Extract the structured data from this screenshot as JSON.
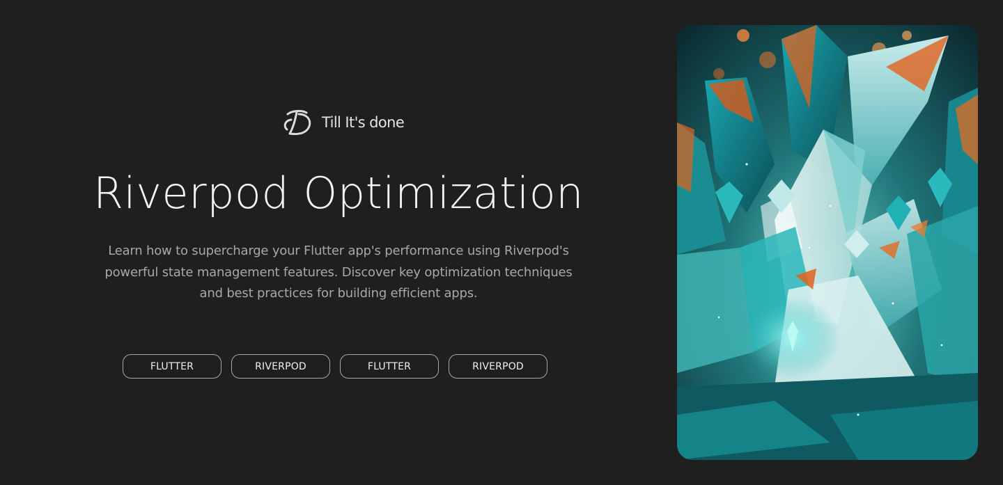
{
  "brand": {
    "name": "Till It's done",
    "logo_icon": "td-monogram-logo"
  },
  "hero": {
    "title": "Riverpod Optimization",
    "description": "Learn how to supercharge your Flutter app's performance using Riverpod's powerful state management features. Discover key optimization techniques and best practices for building efficient apps."
  },
  "tags": [
    "FLUTTER",
    "RIVERPOD",
    "FLUTTER",
    "RIVERPOD"
  ],
  "image": {
    "subject": "teal and orange crystal shards artwork"
  },
  "colors": {
    "background": "#1f1f1f",
    "title": "#f4f4f4",
    "description": "#a8a8a8",
    "tag_border": "#a9a9a9",
    "crystal_teal": "#2bb6b8",
    "crystal_orange": "#e2621d"
  }
}
